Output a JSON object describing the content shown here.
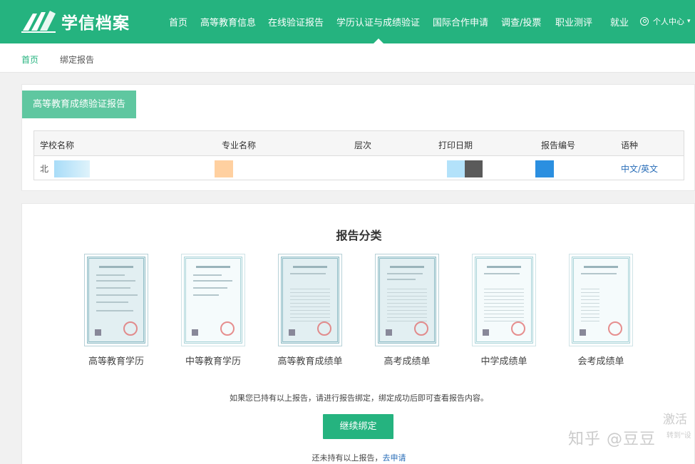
{
  "header": {
    "logo_text": "学信档案",
    "nav": [
      "首页",
      "高等教育信息",
      "在线验证报告",
      "学历认证与成绩验证",
      "国际合作申请",
      "调查/投票",
      "职业测评",
      "就业"
    ],
    "active_index": 3,
    "user_menu": "个人中心"
  },
  "breadcrumb": {
    "home": "首页",
    "current": "绑定报告"
  },
  "report": {
    "tab_label": "高等教育成绩验证报告",
    "columns": [
      "学校名称",
      "专业名称",
      "层次",
      "打印日期",
      "报告编号",
      "语种"
    ],
    "row": {
      "school_partial": "北",
      "language_link": "中文/英文"
    }
  },
  "categories": {
    "title": "报告分类",
    "items": [
      "高等教育学历",
      "中等教育学历",
      "高等教育成绩单",
      "高考成绩单",
      "中学成绩单",
      "会考成绩单"
    ]
  },
  "bind": {
    "tip": "如果您已持有以上报告，请进行报告绑定，绑定成功后即可查看报告内容。",
    "button": "继续绑定",
    "apply_prefix": "还未持有以上报告，",
    "apply_link": "去申请"
  },
  "overlay": {
    "watermark": "知乎 @豆豆",
    "activate": "激活",
    "activate_sub": "转到\"设"
  },
  "colors": {
    "brand": "#25b37f",
    "tab": "#5fc7a0",
    "link": "#2a6eb8"
  }
}
